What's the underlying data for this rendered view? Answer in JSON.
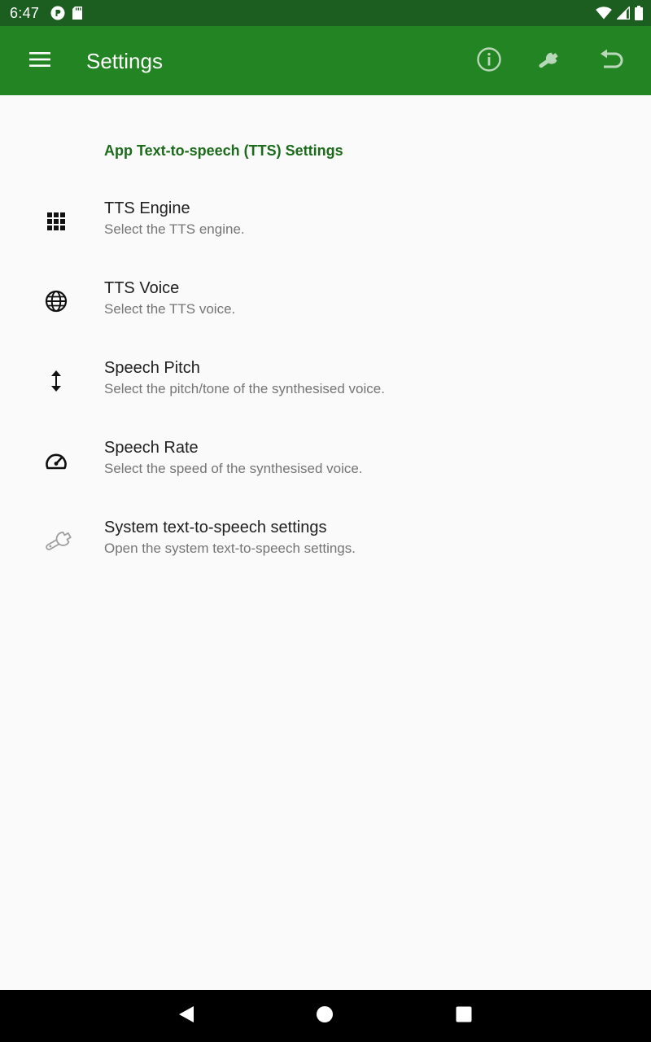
{
  "status_bar": {
    "time": "6:47",
    "left_icons": [
      "notification-badge-icon",
      "sd-card-icon"
    ],
    "right_icons": [
      "wifi-icon",
      "signal-icon",
      "battery-icon"
    ]
  },
  "app_bar": {
    "menu_icon": "hamburger-menu-icon",
    "title": "Settings",
    "actions": [
      "info-icon",
      "wrench-icon",
      "undo-icon"
    ],
    "background_color": "#228422",
    "status_bar_color": "#1b5e20"
  },
  "settings": {
    "category_title": "App Text-to-speech (TTS) Settings",
    "category_color": "#1b6b1b",
    "items": [
      {
        "icon": "grid-icon",
        "title": "TTS Engine",
        "summary": "Select the TTS engine."
      },
      {
        "icon": "globe-icon",
        "title": "TTS Voice",
        "summary": "Select the TTS voice."
      },
      {
        "icon": "vertical-arrows-icon",
        "title": "Speech Pitch",
        "summary": "Select the pitch/tone of the synthesised voice."
      },
      {
        "icon": "speedometer-icon",
        "title": "Speech Rate",
        "summary": "Select the speed of the synthesised voice."
      },
      {
        "icon": "wrench-outline-icon",
        "title": "System text-to-speech settings",
        "summary": "Open the system text-to-speech settings."
      }
    ]
  },
  "nav_bar": {
    "buttons": [
      "back-triangle-icon",
      "home-circle-icon",
      "overview-square-icon"
    ]
  }
}
